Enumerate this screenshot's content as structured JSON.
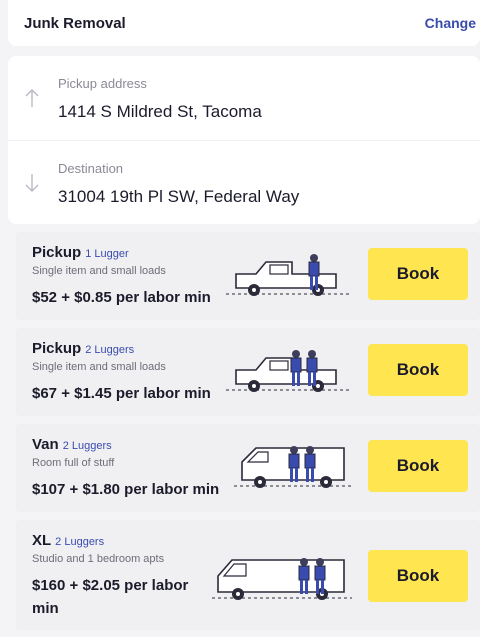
{
  "header": {
    "title": "Junk Removal",
    "change_label": "Change"
  },
  "addresses": {
    "pickup": {
      "label": "Pickup address",
      "value": "1414 S Mildred St, Tacoma"
    },
    "destination": {
      "label": "Destination",
      "value": "31004 19th Pl SW, Federal Way"
    }
  },
  "vehicles": [
    {
      "name": "Pickup",
      "luggers": "1 Lugger",
      "description": "Single item and small loads",
      "price": "$52 + $0.85 per labor min",
      "book_label": "Book",
      "icon": "pickup-truck-icon"
    },
    {
      "name": "Pickup",
      "luggers": "2 Luggers",
      "description": "Single item and small loads",
      "price": "$67 + $1.45 per labor min",
      "book_label": "Book",
      "icon": "pickup-truck-icon"
    },
    {
      "name": "Van",
      "luggers": "2 Luggers",
      "description": "Room full of stuff",
      "price": "$107 + $1.80 per labor min",
      "book_label": "Book",
      "icon": "cargo-van-icon"
    },
    {
      "name": "XL",
      "luggers": "2 Luggers",
      "description": "Studio and 1 bedroom apts",
      "price": "$160 + $2.05 per labor min",
      "book_label": "Book",
      "icon": "xl-van-icon"
    }
  ],
  "colors": {
    "accent": "#ffe54f",
    "link": "#3a4bb0",
    "text": "#1b1b2b",
    "muted": "#6d6d79"
  }
}
